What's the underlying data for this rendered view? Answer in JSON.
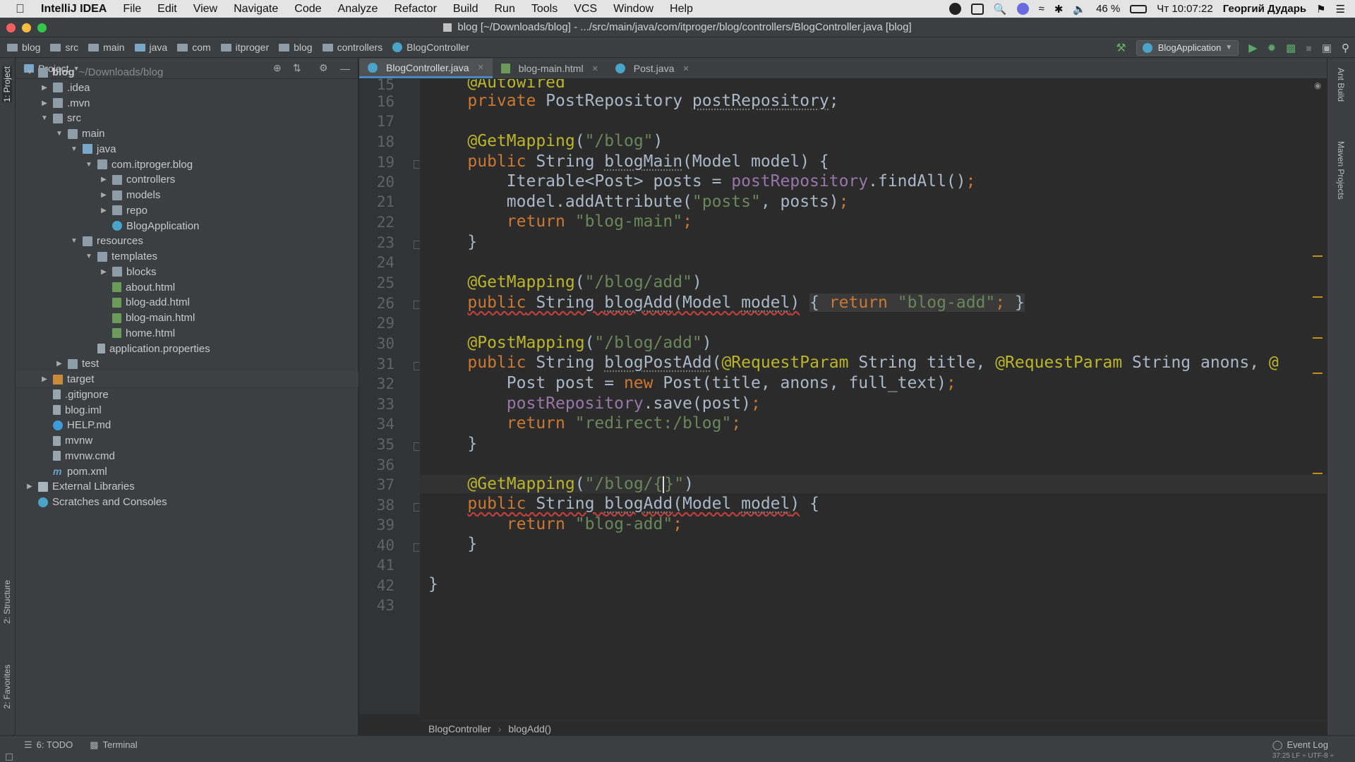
{
  "menubar": {
    "app_name": "IntelliJ IDEA",
    "items": [
      "File",
      "Edit",
      "View",
      "Navigate",
      "Code",
      "Analyze",
      "Refactor",
      "Build",
      "Run",
      "Tools",
      "VCS",
      "Window",
      "Help"
    ],
    "battery": "46 %",
    "clock": "Чт 10:07:22",
    "user": "Георгий Дударь"
  },
  "window": {
    "title": "blog [~/Downloads/blog] - .../src/main/java/com/itproger/blog/controllers/BlogController.java [blog]"
  },
  "navbar": {
    "crumbs": [
      "blog",
      "src",
      "main",
      "java",
      "com",
      "itproger",
      "blog",
      "controllers",
      "BlogController"
    ],
    "run_config": "BlogApplication"
  },
  "project": {
    "header": "Project",
    "tree": [
      {
        "label": "blog",
        "extra": "~/Downloads/blog",
        "depth": 0,
        "arrow": "open",
        "icon": "folder"
      },
      {
        "label": ".idea",
        "depth": 1,
        "arrow": "closed",
        "icon": "folder"
      },
      {
        "label": ".mvn",
        "depth": 1,
        "arrow": "closed",
        "icon": "folder"
      },
      {
        "label": "src",
        "depth": 1,
        "arrow": "open",
        "icon": "folder"
      },
      {
        "label": "main",
        "depth": 2,
        "arrow": "open",
        "icon": "folder"
      },
      {
        "label": "java",
        "depth": 3,
        "arrow": "open",
        "icon": "pkg"
      },
      {
        "label": "com.itproger.blog",
        "depth": 4,
        "arrow": "open",
        "icon": "folder"
      },
      {
        "label": "controllers",
        "depth": 5,
        "arrow": "closed",
        "icon": "folder"
      },
      {
        "label": "models",
        "depth": 5,
        "arrow": "closed",
        "icon": "folder"
      },
      {
        "label": "repo",
        "depth": 5,
        "arrow": "closed",
        "icon": "folder"
      },
      {
        "label": "BlogApplication",
        "depth": 5,
        "arrow": "none",
        "icon": "class"
      },
      {
        "label": "resources",
        "depth": 3,
        "arrow": "open",
        "icon": "folder"
      },
      {
        "label": "templates",
        "depth": 4,
        "arrow": "open",
        "icon": "folder"
      },
      {
        "label": "blocks",
        "depth": 5,
        "arrow": "closed",
        "icon": "folder"
      },
      {
        "label": "about.html",
        "depth": 5,
        "arrow": "none",
        "icon": "html"
      },
      {
        "label": "blog-add.html",
        "depth": 5,
        "arrow": "none",
        "icon": "html"
      },
      {
        "label": "blog-main.html",
        "depth": 5,
        "arrow": "none",
        "icon": "html"
      },
      {
        "label": "home.html",
        "depth": 5,
        "arrow": "none",
        "icon": "html"
      },
      {
        "label": "application.properties",
        "depth": 4,
        "arrow": "none",
        "icon": "file"
      },
      {
        "label": "test",
        "depth": 2,
        "arrow": "closed",
        "icon": "folder"
      },
      {
        "label": "target",
        "depth": 1,
        "arrow": "closed",
        "icon": "orange"
      },
      {
        "label": ".gitignore",
        "depth": 1,
        "arrow": "none",
        "icon": "file"
      },
      {
        "label": "blog.iml",
        "depth": 1,
        "arrow": "none",
        "icon": "file"
      },
      {
        "label": "HELP.md",
        "depth": 1,
        "arrow": "none",
        "icon": "md"
      },
      {
        "label": "mvnw",
        "depth": 1,
        "arrow": "none",
        "icon": "file"
      },
      {
        "label": "mvnw.cmd",
        "depth": 1,
        "arrow": "none",
        "icon": "file"
      },
      {
        "label": "pom.xml",
        "depth": 1,
        "arrow": "none",
        "icon": "maven"
      },
      {
        "label": "External Libraries",
        "depth": 0,
        "arrow": "closed",
        "icon": "lib"
      },
      {
        "label": "Scratches and Consoles",
        "depth": 0,
        "arrow": "none",
        "icon": "class"
      }
    ]
  },
  "tabs": [
    {
      "label": "BlogController.java",
      "active": true
    },
    {
      "label": "blog-main.html",
      "active": false
    },
    {
      "label": "Post.java",
      "active": false
    }
  ],
  "editor": {
    "line_numbers": [
      "15",
      "16",
      "17",
      "18",
      "19",
      "20",
      "21",
      "22",
      "23",
      "24",
      "25",
      "26",
      "29",
      "30",
      "31",
      "32",
      "33",
      "34",
      "35",
      "36",
      "37",
      "38",
      "39",
      "40",
      "41",
      "42",
      "43"
    ],
    "breadcrumb": [
      "BlogController",
      "blogAdd()"
    ]
  },
  "side_tools": {
    "left": [
      "1: Project",
      "2: Structure",
      "2: Favorites"
    ],
    "right": [
      "Ant Build",
      "Maven Projects"
    ]
  },
  "bottom": {
    "todo": "6: TODO",
    "terminal": "Terminal",
    "event_log": "Event Log",
    "status_partial": "37:25   LF ÷   UTF-8 ÷"
  }
}
